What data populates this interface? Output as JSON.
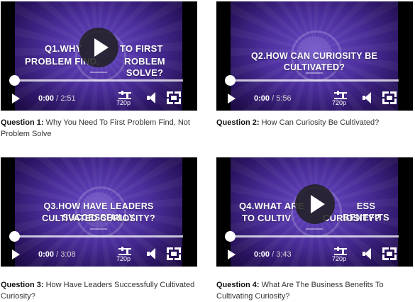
{
  "videos": [
    {
      "overlay_lines": [
        "Q1.WHY",
        "TO FIRST",
        "PROBLEM FIND,",
        "ROBLEM SOLVE?"
      ],
      "time_current": "0:00",
      "time_separator": "/",
      "duration": "2:51",
      "quality": "720p",
      "caption_label": "Question 1:",
      "caption_text": "Why You Need To First Problem Find, Not Problem Solve",
      "big_play_visible": true,
      "progress": 0
    },
    {
      "overlay_lines": [
        "Q2.HOW CAN CURIOSITY BE CULTIVATED?"
      ],
      "time_current": "0:00",
      "time_separator": "/",
      "duration": "5:56",
      "quality": "720p",
      "caption_label": "Question 2:",
      "caption_text": "How Can Curiosity Be Cultivated?",
      "big_play_visible": false,
      "progress": 0
    },
    {
      "overlay_lines": [
        "Q3.HOW HAVE LEADERS SUCCESSFULLY",
        "CULTIVATED CURIOSITY?"
      ],
      "time_current": "0:00",
      "time_separator": "/",
      "duration": "3:08",
      "quality": "720p",
      "caption_label": "Question 3:",
      "caption_text": "How Have Leaders Successfully Cultivated Curiosity?",
      "big_play_visible": false,
      "progress": 0
    },
    {
      "overlay_lines": [
        "Q4.WHAT ARE",
        "ESS BENEFITS",
        "TO CULTIV",
        "CURIOSITY?"
      ],
      "time_current": "0:00",
      "time_separator": "/",
      "duration": "3:43",
      "quality": "720p",
      "caption_label": "Question 4:",
      "caption_text": "What Are The Business Benefits To Cultivating Curiosity?",
      "big_play_visible": true,
      "progress": 0
    }
  ],
  "colors": {
    "video_bg": "#4a2d99",
    "caption_text": "#333333"
  }
}
